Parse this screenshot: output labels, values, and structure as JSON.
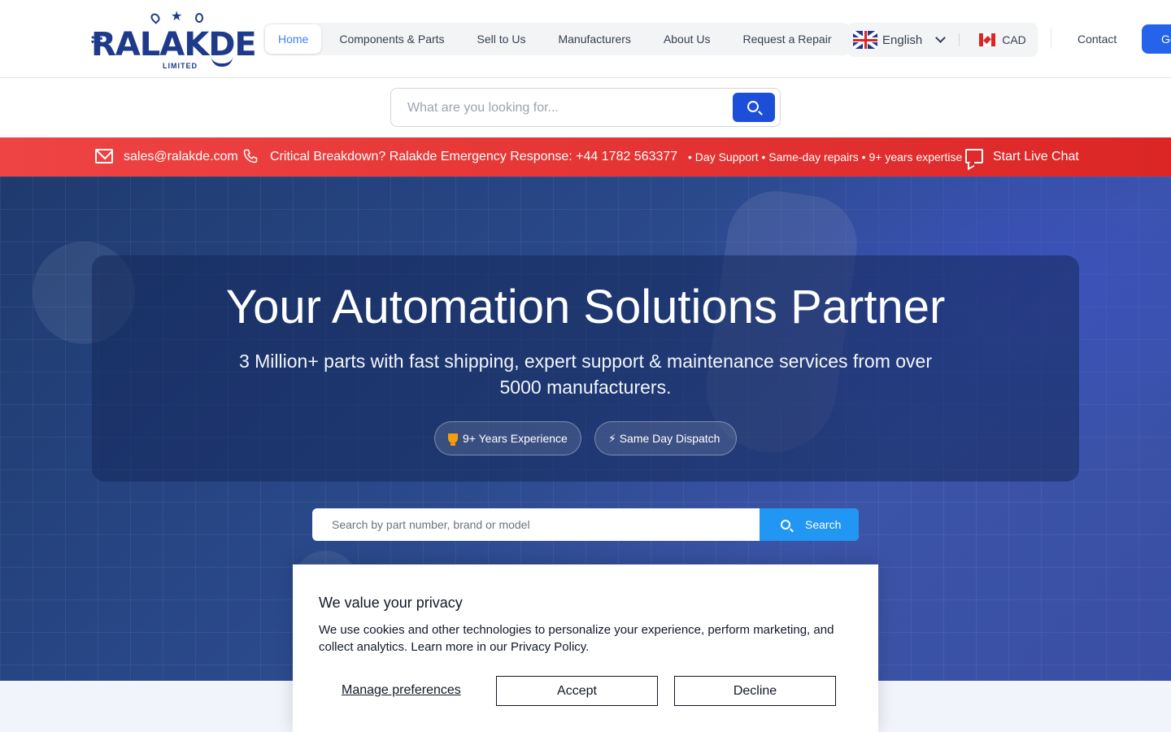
{
  "brand": {
    "name": "RALAKDE",
    "suffix": "LIMITED"
  },
  "nav": {
    "items": [
      {
        "label": "Home",
        "active": true
      },
      {
        "label": "Components & Parts",
        "active": false
      },
      {
        "label": "Sell to Us",
        "active": false
      },
      {
        "label": "Manufacturers",
        "active": false
      },
      {
        "label": "About Us",
        "active": false
      },
      {
        "label": "Request a Repair",
        "active": false
      }
    ]
  },
  "locale": {
    "language": "English",
    "currency": "CAD"
  },
  "header": {
    "contact_label": "Contact",
    "cta_label": "Get"
  },
  "top_search": {
    "placeholder": "What are you looking for..."
  },
  "alert_bar": {
    "email": "sales@ralakde.com",
    "emergency": "Critical Breakdown? Ralakde Emergency Response: +44 1782 563377",
    "extra": "• Day Support • Same-day repairs • 9+ years expertise",
    "chat_label": "Start Live Chat"
  },
  "hero": {
    "title": "Your Automation Solutions Partner",
    "subtitle": "3 Million+ parts with fast shipping, expert support & maintenance services from over 5000 manufacturers.",
    "badges": [
      {
        "icon": "trophy-icon",
        "label": "9+ Years Experience"
      },
      {
        "icon": "lightning-icon",
        "label": "⚡ Same Day Dispatch"
      }
    ],
    "search": {
      "placeholder": "Search by part number, brand or model",
      "button_label": "Search"
    }
  },
  "cookie": {
    "title": "We value your privacy",
    "text": "We use cookies and other technologies to personalize your experience, perform marketing, and collect analytics. Learn more in our Privacy Policy.",
    "manage_label": "Manage preferences",
    "accept_label": "Accept",
    "decline_label": "Decline"
  },
  "colors": {
    "primary": "#2563eb",
    "alert": "#dc2626",
    "brand": "#1e3a8a"
  }
}
